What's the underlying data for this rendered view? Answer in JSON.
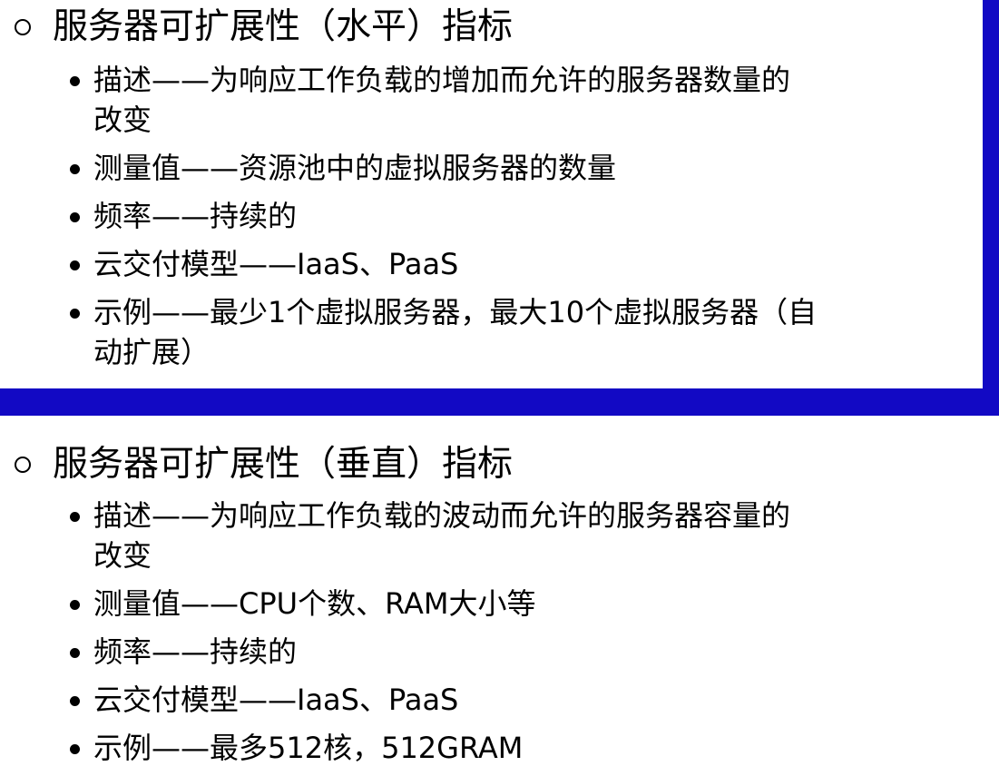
{
  "sections": [
    {
      "heading": "服务器可扩展性（水平）指标",
      "items": [
        {
          "lines": [
            "描述——为响应工作负载的增加而允许的服务器数量的",
            "改变"
          ]
        },
        {
          "lines": [
            "测量值——资源池中的虚拟服务器的数量"
          ]
        },
        {
          "lines": [
            "频率——持续的"
          ]
        },
        {
          "lines": [
            "云交付模型——IaaS、PaaS"
          ]
        },
        {
          "lines": [
            "示例——最少1个虚拟服务器，最大10个虚拟服务器（自",
            "动扩展）"
          ]
        }
      ]
    },
    {
      "heading": "服务器可扩展性（垂直）指标",
      "items": [
        {
          "lines": [
            "描述——为响应工作负载的波动而允许的服务器容量的",
            "改变"
          ]
        },
        {
          "lines": [
            "测量值——CPU个数、RAM大小等"
          ]
        },
        {
          "lines": [
            "频率——持续的"
          ]
        },
        {
          "lines": [
            "云交付模型——IaaS、PaaS"
          ]
        },
        {
          "lines": [
            "示例——最多512核，512GRAM"
          ]
        }
      ]
    }
  ],
  "colors": {
    "frame": "#1209c4",
    "text": "#000000",
    "background": "#ffffff"
  }
}
